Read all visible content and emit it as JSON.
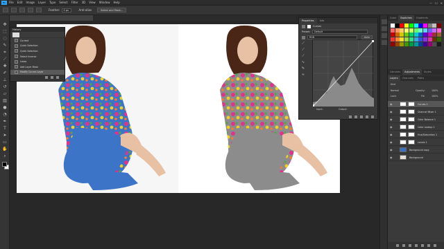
{
  "app": {
    "logo_text": "Ps",
    "menus": [
      "File",
      "Edit",
      "Image",
      "Layer",
      "Type",
      "Select",
      "Filter",
      "3D",
      "View",
      "Window",
      "Help"
    ],
    "window_controls": [
      "—",
      "☐",
      "✕"
    ]
  },
  "options_bar": {
    "feather_label": "Feather:",
    "feather_value": "0 px",
    "antialias_label": "Anti-alias",
    "select_mask_button": "Select and Mask..."
  },
  "history_panel": {
    "title": "History",
    "items": [
      {
        "label": "Current",
        "selected": false
      },
      {
        "label": "Quick Selection",
        "selected": false
      },
      {
        "label": "Quick Selection",
        "selected": false
      },
      {
        "label": "Select Inverse",
        "selected": false
      },
      {
        "label": "Lasso",
        "selected": false
      },
      {
        "label": "Add Layer Mask",
        "selected": false
      },
      {
        "label": "Modify Curves Layer",
        "selected": true
      }
    ]
  },
  "properties_panel": {
    "tabs": [
      {
        "label": "Properties",
        "active": true
      },
      {
        "label": "Info",
        "active": false
      }
    ],
    "adjustment_name": "Curves",
    "preset_label": "Preset:",
    "preset_value": "Default",
    "channel_value": "RGB",
    "auto_button": "Auto",
    "input_label": "Input:",
    "output_label": "Output:"
  },
  "color_panel": {
    "tabs": [
      {
        "label": "Color",
        "active": false
      },
      {
        "label": "Swatches",
        "active": true
      },
      {
        "label": "Gradients",
        "active": false
      }
    ],
    "swatch_colors": [
      "#ffffff",
      "#000000",
      "#ff0000",
      "#ffff00",
      "#00ff00",
      "#00ffff",
      "#0000ff",
      "#ff00ff",
      "#808080",
      "#c0c0c0",
      "#800000",
      "#ff6666",
      "#ff9966",
      "#ffcc66",
      "#ffff66",
      "#ccff66",
      "#66ff66",
      "#66ffcc",
      "#66ccff",
      "#6666ff",
      "#cc66ff",
      "#ff66cc",
      "#cc0000",
      "#cc6600",
      "#cccc00",
      "#66cc00",
      "#00cc66",
      "#00cccc",
      "#0066cc",
      "#6600cc",
      "#cc00cc",
      "#993333",
      "#996633",
      "#ff3333",
      "#ff8833",
      "#ffdd33",
      "#99dd33",
      "#33dd88",
      "#33aadd",
      "#3355dd",
      "#8833dd",
      "#dd33aa",
      "#663300",
      "#336600",
      "#990000",
      "#994400",
      "#999900",
      "#449900",
      "#009944",
      "#009999",
      "#004499",
      "#440099",
      "#990077",
      "#4d4d4d",
      "#1a1a1a"
    ]
  },
  "adjustments_tabs": [
    {
      "label": "Libraries",
      "active": false
    },
    {
      "label": "Adjustments",
      "active": false
    },
    {
      "label": "Styles",
      "active": false
    }
  ],
  "layers_panel": {
    "tabs": [
      {
        "label": "Layers",
        "active": true
      },
      {
        "label": "Channels",
        "active": false
      },
      {
        "label": "Paths",
        "active": false
      }
    ],
    "kind_label": "Kind",
    "blend_mode": "Normal",
    "opacity_label": "Opacity:",
    "opacity_value": "100%",
    "lock_label": "Lock:",
    "fill_label": "Fill:",
    "fill_value": "100%",
    "layers": [
      {
        "name": "Curves 1",
        "selected": true,
        "thumb": "#ffffff"
      },
      {
        "name": "Channel Mixer 1",
        "selected": false,
        "thumb": "#ffffff"
      },
      {
        "name": "Color Balance 1",
        "selected": false,
        "thumb": "#ffffff"
      },
      {
        "name": "Color Lookup 1",
        "selected": false,
        "thumb": "#ffffff"
      },
      {
        "name": "Hue/Saturation 1",
        "selected": false,
        "thumb": "#ffffff"
      },
      {
        "name": "Levels 1",
        "selected": false,
        "thumb": "#ffffff"
      },
      {
        "name": "Background copy",
        "selected": false,
        "thumb": "#3a6fc0"
      },
      {
        "name": "Background",
        "selected": false,
        "thumb": "#e8e0d8"
      }
    ]
  },
  "colors": {
    "accent": "#31a8ff",
    "dress_blue": "#3c74c8",
    "dress_gray": "#8a8a8a"
  }
}
